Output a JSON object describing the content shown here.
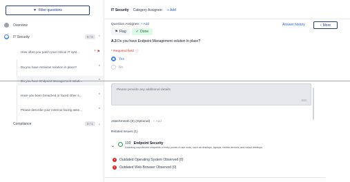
{
  "sidebar": {
    "filter_label": "Filter questions",
    "overview_label": "Overview",
    "section": {
      "label": "IT Security",
      "count": "5 / 5"
    },
    "questions": [
      {
        "text": "How often you patch your critical IT syst...",
        "flag": "⚑",
        "required": "*"
      },
      {
        "text": "Do you have Antivirus solution in place?",
        "required": "*"
      },
      {
        "text": "Do you have Endpoint Management soluti...",
        "required": "*"
      },
      {
        "text": "Have you been breached or faced other s...",
        "required": "*"
      },
      {
        "text": "Please describe your external facing asse...",
        "required": "*"
      }
    ],
    "compliance": {
      "label": "Compliance",
      "count": "0 / 1"
    }
  },
  "main": {
    "tab_active": "IT Security",
    "category_assignee_label": "Category Assignee:",
    "category_add": "+ Add",
    "question_assignee_label": "Question Assignee:",
    "question_add": "+ Add",
    "answer_history": "Answer history",
    "more_label": "More",
    "flag_label": "Flag",
    "done_label": "Done",
    "question_number": "A.3",
    "question_text": "Do you have Endpoint Management solution in place?",
    "required_label": "* Required field",
    "options": [
      "Yes",
      "No"
    ],
    "details_placeholder": "Please provide any additional details",
    "char_count": "500",
    "attachments_label": "Attachments (0) (Optional)",
    "attachments_add": "+ Add",
    "related_label": "Related issues (1)",
    "issue": {
      "score": "100",
      "title": "Endpoint Security",
      "description": "Detecting unprotected endpoints or entry points of user tools, such as desktops, laptops, mobile devices, and virtual desktops"
    },
    "findings": [
      "Outdated Operating System Observed (0)",
      "Outdated Web Browser Observed (0)"
    ]
  },
  "colors": {
    "accent": "#2563eb",
    "brand": "#1e3a8a",
    "danger": "#dc2626",
    "success": "#16a34a"
  }
}
